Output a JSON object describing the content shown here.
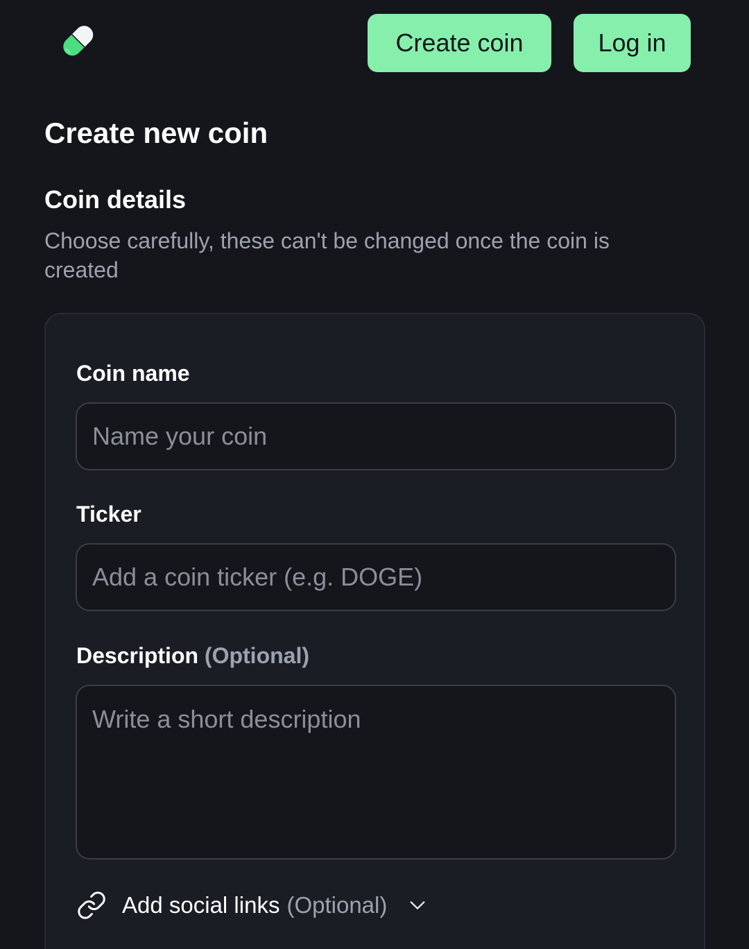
{
  "header": {
    "logo_icon": "pill-icon",
    "create_coin_label": "Create coin",
    "login_label": "Log in",
    "accent_color": "#86efac"
  },
  "page": {
    "title": "Create new coin"
  },
  "section": {
    "title": "Coin details",
    "description": "Choose carefully, these can't be changed once the coin is created"
  },
  "form": {
    "name": {
      "label": "Coin name",
      "placeholder": "Name your coin",
      "value": ""
    },
    "ticker": {
      "label": "Ticker",
      "placeholder": "Add a coin ticker (e.g. DOGE)",
      "value": ""
    },
    "description": {
      "label": "Description",
      "optional": "(Optional)",
      "placeholder": "Write a short description",
      "value": ""
    },
    "social": {
      "icon": "link-icon",
      "label": "Add social links",
      "optional": "(Optional)",
      "chevron_icon": "chevron-down-icon"
    }
  }
}
